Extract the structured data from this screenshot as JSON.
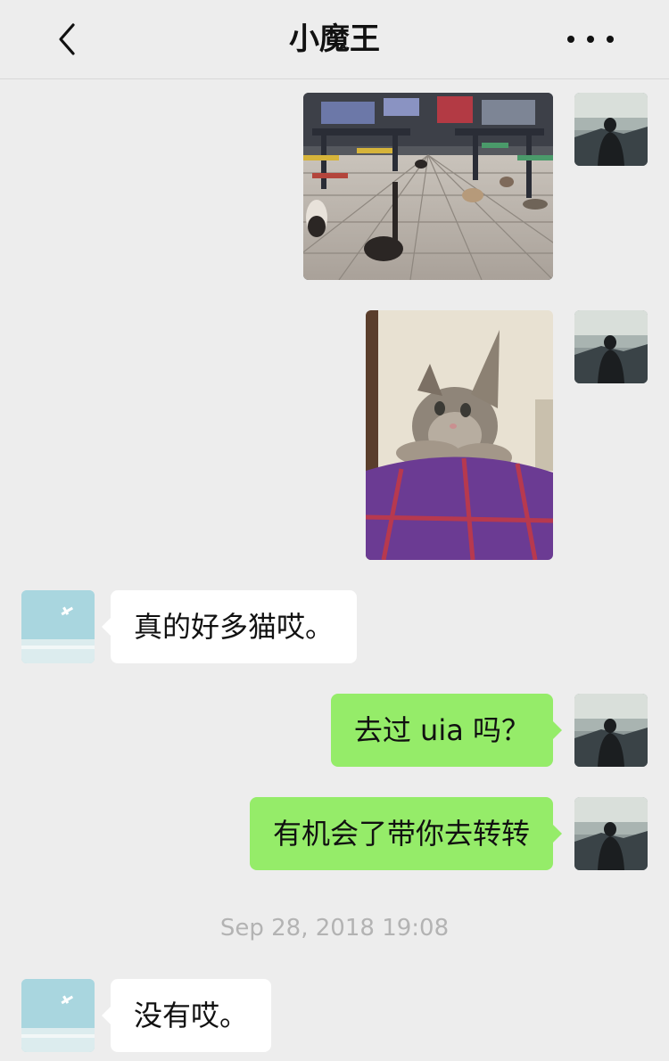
{
  "header": {
    "title": "小魔王",
    "back_icon": "chevron-left-icon",
    "more_icon": "more-dots-icon"
  },
  "messages": [
    {
      "sender": "me",
      "type": "image",
      "description": "cafeteria-cats-photo"
    },
    {
      "sender": "me",
      "type": "image",
      "description": "kitten-photo"
    },
    {
      "sender": "friend",
      "type": "text",
      "text": "真的好多猫哎。"
    },
    {
      "sender": "me",
      "type": "text",
      "text": "去过 uia 吗？"
    },
    {
      "sender": "me",
      "type": "text",
      "text": "有机会了带你去转转"
    },
    {
      "type": "timestamp",
      "text": "Sep 28, 2018 19:08"
    },
    {
      "sender": "friend",
      "type": "text",
      "text": "没有哎。"
    }
  ],
  "colors": {
    "background": "#ededed",
    "bubble_out": "#95ec69",
    "bubble_in": "#ffffff",
    "timestamp": "#b3b3b3"
  }
}
